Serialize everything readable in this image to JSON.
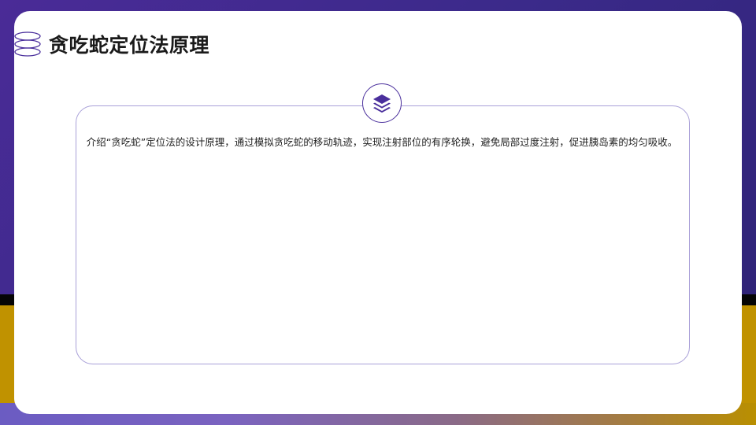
{
  "slide": {
    "title": "贪吃蛇定位法原理",
    "card": {
      "icon": "layers-icon",
      "text": "介绍“贪吃蛇”定位法的设计原理，通过模拟贪吃蛇的移动轨迹，实现注射部位的有序轮换，避免局部过度注射，促进胰岛素的均匀吸收。"
    }
  },
  "colors": {
    "accent_purple": "#4a2f9c",
    "background_purple": "#3f2a8c",
    "background_gold": "#c09200",
    "card_border": "#a9a0d8"
  }
}
